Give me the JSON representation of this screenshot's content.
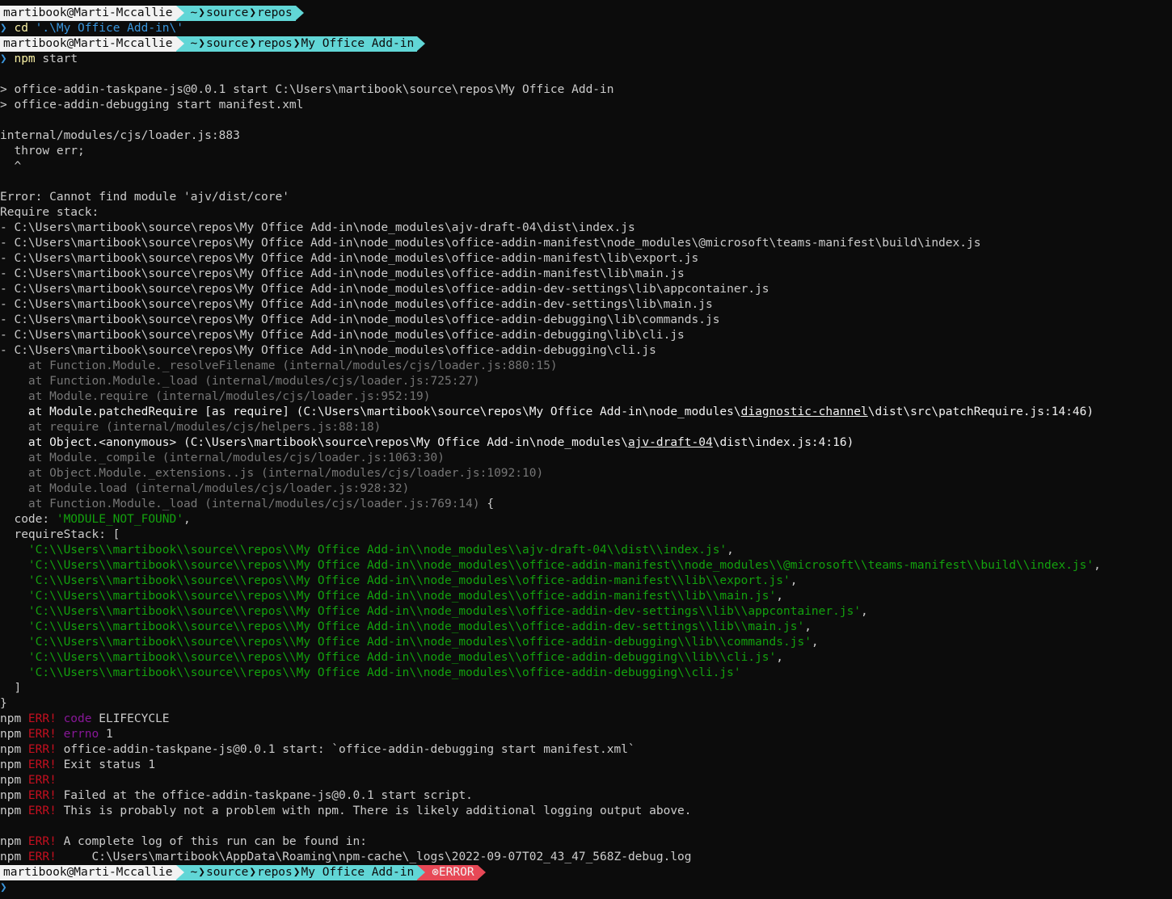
{
  "prompt": {
    "user": "martibook@Marti-Mccallie",
    "home": "~",
    "sep": "❯",
    "path1": [
      "source",
      "repos"
    ],
    "path2": [
      "source",
      "repos",
      "My Office Add-in"
    ],
    "error_label": "ERROR",
    "error_icon": "⊗",
    "chevron": "❯"
  },
  "cmd_cd": {
    "cmd": "cd",
    "arg": "'.\\My Office Add-in\\'"
  },
  "cmd_npm": {
    "cmd": "npm",
    "arg": "start"
  },
  "run_lines": [
    "> office-addin-taskpane-js@0.0.1 start C:\\Users\\martibook\\source\\repos\\My Office Add-in",
    "> office-addin-debugging start manifest.xml"
  ],
  "throw_lines": [
    "internal/modules/cjs/loader.js:883",
    "  throw err;",
    "  ^"
  ],
  "error_msg": "Error: Cannot find module 'ajv/dist/core'",
  "require_stack_label": "Require stack:",
  "require_stack": [
    "- C:\\Users\\martibook\\source\\repos\\My Office Add-in\\node_modules\\ajv-draft-04\\dist\\index.js",
    "- C:\\Users\\martibook\\source\\repos\\My Office Add-in\\node_modules\\office-addin-manifest\\node_modules\\@microsoft\\teams-manifest\\build\\index.js",
    "- C:\\Users\\martibook\\source\\repos\\My Office Add-in\\node_modules\\office-addin-manifest\\lib\\export.js",
    "- C:\\Users\\martibook\\source\\repos\\My Office Add-in\\node_modules\\office-addin-manifest\\lib\\main.js",
    "- C:\\Users\\martibook\\source\\repos\\My Office Add-in\\node_modules\\office-addin-dev-settings\\lib\\appcontainer.js",
    "- C:\\Users\\martibook\\source\\repos\\My Office Add-in\\node_modules\\office-addin-dev-settings\\lib\\main.js",
    "- C:\\Users\\martibook\\source\\repos\\My Office Add-in\\node_modules\\office-addin-debugging\\lib\\commands.js",
    "- C:\\Users\\martibook\\source\\repos\\My Office Add-in\\node_modules\\office-addin-debugging\\lib\\cli.js",
    "- C:\\Users\\martibook\\source\\repos\\My Office Add-in\\node_modules\\office-addin-debugging\\cli.js"
  ],
  "trace": {
    "t1": "    at Function.Module._resolveFilename (internal/modules/cjs/loader.js:880:15)",
    "t2": "    at Function.Module._load (internal/modules/cjs/loader.js:725:27)",
    "t3": "    at Module.require (internal/modules/cjs/loader.js:952:19)",
    "t4": {
      "pre": "    at Module.patchedRequire [as require] (C:\\Users\\martibook\\source\\repos\\My Office Add-in\\node_modules\\",
      "u": "diagnostic-channel",
      "post": "\\dist\\src\\patchRequire.js:14:46)"
    },
    "t5": "    at require (internal/modules/cjs/helpers.js:88:18)",
    "t6": {
      "pre": "    at Object.<anonymous> (C:\\Users\\martibook\\source\\repos\\My Office Add-in\\node_modules\\",
      "u": "ajv-draft-04",
      "post": "\\dist\\index.js:4:16)"
    },
    "t7": "    at Module._compile (internal/modules/cjs/loader.js:1063:30)",
    "t8": "    at Object.Module._extensions..js (internal/modules/cjs/loader.js:1092:10)",
    "t9": "    at Module.load (internal/modules/cjs/loader.js:928:32)",
    "t10": "    at Function.Module._load (internal/modules/cjs/loader.js:769:14)",
    "t10_brace": " {"
  },
  "code_key": "  code: ",
  "code_val": "'MODULE_NOT_FOUND'",
  "comma": ",",
  "require_stack_key": "  requireStack: [",
  "require_stack_strings": [
    "    'C:\\\\Users\\\\martibook\\\\source\\\\repos\\\\My Office Add-in\\\\node_modules\\\\ajv-draft-04\\\\dist\\\\index.js'",
    "    'C:\\\\Users\\\\martibook\\\\source\\\\repos\\\\My Office Add-in\\\\node_modules\\\\office-addin-manifest\\\\node_modules\\\\@microsoft\\\\teams-manifest\\\\build\\\\index.js'",
    "    'C:\\\\Users\\\\martibook\\\\source\\\\repos\\\\My Office Add-in\\\\node_modules\\\\office-addin-manifest\\\\lib\\\\export.js'",
    "    'C:\\\\Users\\\\martibook\\\\source\\\\repos\\\\My Office Add-in\\\\node_modules\\\\office-addin-manifest\\\\lib\\\\main.js'",
    "    'C:\\\\Users\\\\martibook\\\\source\\\\repos\\\\My Office Add-in\\\\node_modules\\\\office-addin-dev-settings\\\\lib\\\\appcontainer.js'",
    "    'C:\\\\Users\\\\martibook\\\\source\\\\repos\\\\My Office Add-in\\\\node_modules\\\\office-addin-dev-settings\\\\lib\\\\main.js'",
    "    'C:\\\\Users\\\\martibook\\\\source\\\\repos\\\\My Office Add-in\\\\node_modules\\\\office-addin-debugging\\\\lib\\\\commands.js'",
    "    'C:\\\\Users\\\\martibook\\\\source\\\\repos\\\\My Office Add-in\\\\node_modules\\\\office-addin-debugging\\\\lib\\\\cli.js'",
    "    'C:\\\\Users\\\\martibook\\\\source\\\\repos\\\\My Office Add-in\\\\node_modules\\\\office-addin-debugging\\\\cli.js'"
  ],
  "close_bracket": "  ]",
  "close_brace": "}",
  "npm": {
    "prefix": "npm ",
    "err": "ERR!",
    "l1_key": "code",
    "l1_val": " ELIFECYCLE",
    "l2_key": "errno",
    "l2_val": " 1",
    "l3": " office-addin-taskpane-js@0.0.1 start: `office-addin-debugging start manifest.xml`",
    "l4": " Exit status 1",
    "l6": " Failed at the office-addin-taskpane-js@0.0.1 start script.",
    "l7": " This is probably not a problem with npm. There is likely additional logging output above.",
    "l9": " A complete log of this run can be found in:",
    "l10": "     C:\\Users\\martibook\\AppData\\Roaming\\npm-cache\\_logs\\2022-09-07T02_43_47_568Z-debug.log"
  }
}
